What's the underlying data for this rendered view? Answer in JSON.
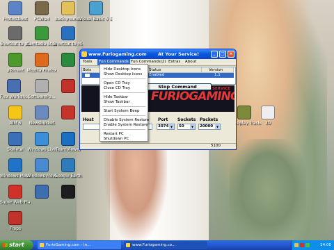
{
  "desktop": {
    "icons": [
      {
        "label": "Protectboot",
        "color": "#5a84c7"
      },
      {
        "label": "PCWiz4",
        "color": "#7a6a4a"
      },
      {
        "label": "backgrounds",
        "color": "#e3c15a"
      },
      {
        "label": "Visual Basic 6 Enterprise",
        "color": "#4aa0d0"
      },
      {
        "label": "Shortcut to pocket pc",
        "color": "#6b6b6b"
      },
      {
        "label": "Camtasia Studio 6",
        "color": "#3c9a3c"
      },
      {
        "label": "Shortcut to Microsoft",
        "color": "#2a70c0"
      },
      {
        "label": "µTorrent",
        "color": "#4c9a2a"
      },
      {
        "label": "Mozilla Firefox",
        "color": "#e06a1b"
      },
      {
        "label": "",
        "color": "#2b8a3e"
      },
      {
        "label": "Flex Workshop Flex Editor",
        "color": "#4a6fb0"
      },
      {
        "label": "SoftwarePa...",
        "color": "#b0b0b0"
      },
      {
        "label": "",
        "color": "#c0322a"
      },
      {
        "label": "AIM 6",
        "color": "#f5c518"
      },
      {
        "label": "Newsbucket",
        "color": "#6a8bbf"
      },
      {
        "label": "",
        "color": "#c4342a"
      },
      {
        "label": "Skeletal",
        "color": "#3b70b8"
      },
      {
        "label": "Windows Live",
        "color": "#3b8fd8"
      },
      {
        "label": "TeamViewer",
        "color": "#1b6fc2"
      },
      {
        "label": "Windows Media Player",
        "color": "#1f74c8"
      },
      {
        "label": "Windows Movie Maker",
        "color": "#4a8ad0"
      },
      {
        "label": "Google Earth",
        "color": "#2f7ab8"
      },
      {
        "label": "Super Web Player",
        "color": "#d0322a"
      },
      {
        "label": "",
        "color": "#3d6fb0"
      },
      {
        "label": "",
        "color": "#1d1d1d"
      },
      {
        "label": "Fraps",
        "color": "#c0322a"
      },
      {
        "label": "Gameplay Tracker v1",
        "color": "#7c8a3a"
      },
      {
        "label": "3D",
        "color": "#eeeeee"
      }
    ]
  },
  "window": {
    "title": "www.Furiogaming.com",
    "title_right": "At Your Service!",
    "controls": {
      "minimize": "_",
      "maximize": "□",
      "close": "×"
    },
    "menu": [
      "Tools",
      "Fun Commands",
      "Fun Commands(2)",
      "Extras",
      "About"
    ],
    "table": {
      "headers": [
        "Bots Conne",
        "Status",
        "Version"
      ],
      "row": {
        "status": "Enabled",
        "version": "1.1"
      }
    },
    "banner": {
      "tagline": "AT YOUR SERVICE",
      "logo": "FURIOGAMING.COM"
    },
    "fields": {
      "host_label": "Host",
      "port_label": "Port",
      "sockets_label": "Sockets",
      "packets_label": "Packets",
      "port_value": "3074",
      "sockets_value": "50",
      "packets_value": "20000"
    },
    "stop_button": "Stop Command",
    "status_value": "5100"
  },
  "dropdown": {
    "groups": [
      [
        "Hide Desktop Icons",
        "Show Desktop Icons"
      ],
      [
        "Open CD Tray",
        "Close CD Tray"
      ],
      [
        "Hide Taskbar",
        "Show Taskbar"
      ],
      [
        "Start System Beep"
      ],
      [
        "Disable System Restore",
        "Enable System Restore"
      ],
      [
        "Restart PC",
        "Shutdown PC"
      ]
    ]
  },
  "taskbar": {
    "start_label": "start",
    "items": [
      "FurioGaming.com - In...",
      "www.Furiogaming.co..."
    ],
    "clock": "14:00"
  }
}
